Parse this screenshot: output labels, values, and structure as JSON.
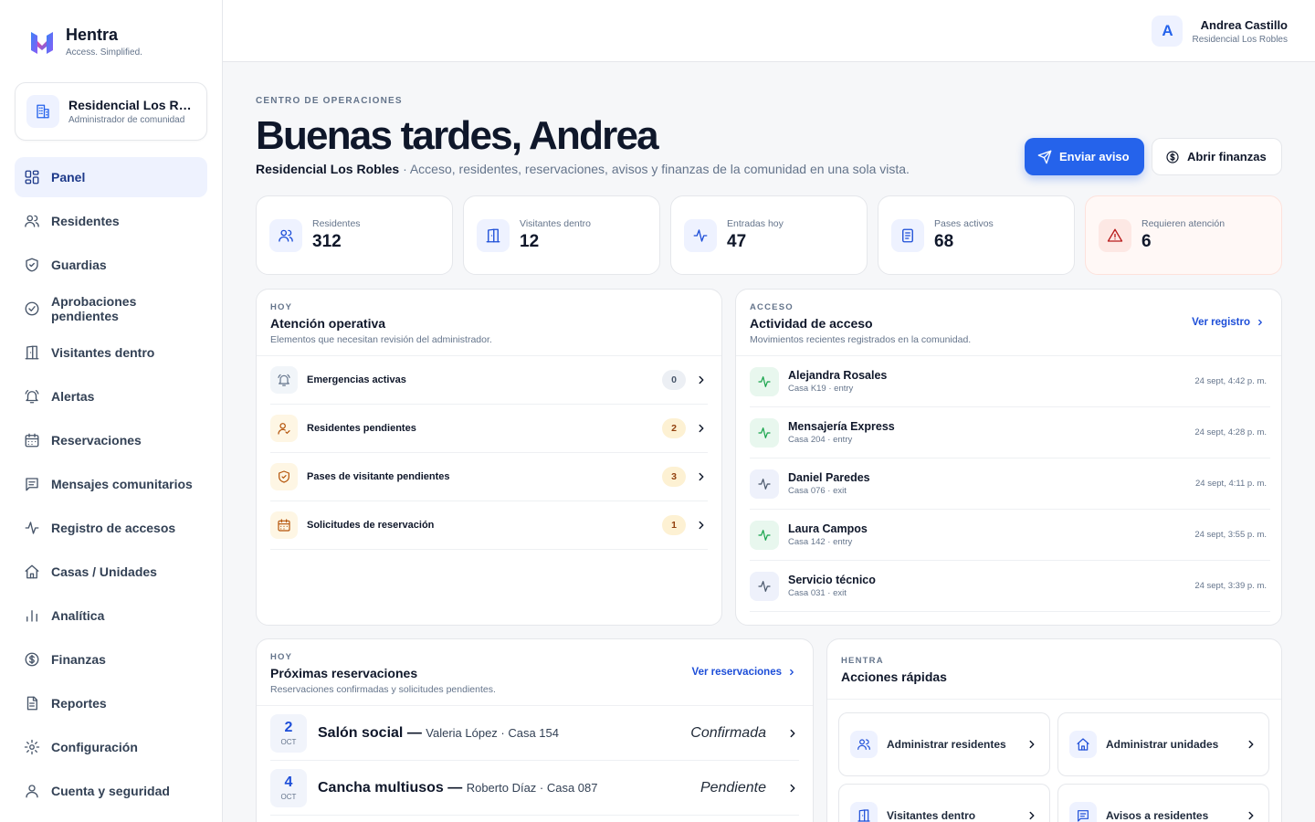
{
  "brand": {
    "name": "Hentra",
    "tagline": "Access. Simplified."
  },
  "community": {
    "name": "Residencial Los Robles",
    "role": "Administrador de comunidad"
  },
  "nav": [
    {
      "label": "Panel",
      "icon": "grid-icon",
      "active": true
    },
    {
      "label": "Residentes",
      "icon": "users-icon"
    },
    {
      "label": "Guardias",
      "icon": "shield-icon"
    },
    {
      "label": "Aprobaciones pendientes",
      "icon": "check-circle-icon"
    },
    {
      "label": "Visitantes dentro",
      "icon": "door-icon"
    },
    {
      "label": "Alertas",
      "icon": "bell-icon"
    },
    {
      "label": "Reservaciones",
      "icon": "calendar-icon"
    },
    {
      "label": "Mensajes comunitarios",
      "icon": "message-icon"
    },
    {
      "label": "Registro de accesos",
      "icon": "activity-icon"
    },
    {
      "label": "Casas / Unidades",
      "icon": "home-icon"
    },
    {
      "label": "Analítica",
      "icon": "bar-chart-icon"
    },
    {
      "label": "Finanzas",
      "icon": "dollar-icon"
    },
    {
      "label": "Reportes",
      "icon": "file-icon"
    },
    {
      "label": "Configuración",
      "icon": "gear-icon"
    },
    {
      "label": "Cuenta y seguridad",
      "icon": "user-icon"
    }
  ],
  "user": {
    "initial": "A",
    "name": "Andrea Castillo",
    "community": "Residencial Los Robles"
  },
  "header": {
    "eyebrow": "CENTRO DE OPERACIONES",
    "title": "Buenas tardes, Andrea",
    "community": "Residencial Los Robles",
    "subtitle": "· Acceso, residentes, reservaciones, avisos y finanzas de la comunidad en una sola vista.",
    "primary_button": "Enviar aviso",
    "secondary_button": "Abrir finanzas"
  },
  "stats": [
    {
      "label": "Residentes",
      "value": "312",
      "icon": "users-icon"
    },
    {
      "label": "Visitantes dentro",
      "value": "12",
      "icon": "door-icon"
    },
    {
      "label": "Entradas hoy",
      "value": "47",
      "icon": "activity-icon"
    },
    {
      "label": "Pases activos",
      "value": "68",
      "icon": "document-icon"
    },
    {
      "label": "Requieren atención",
      "value": "6",
      "icon": "warning-icon"
    }
  ],
  "attention": {
    "eyebrow": "HOY",
    "title": "Atención operativa",
    "subtitle": "Elementos que necesitan revisión del administrador.",
    "items": [
      {
        "label": "Emergencias activas",
        "count": "0",
        "icon": "bell-icon",
        "tone": "neutral"
      },
      {
        "label": "Residentes pendientes",
        "count": "2",
        "icon": "user-check-icon",
        "tone": "amber"
      },
      {
        "label": "Pases de visitante pendientes",
        "count": "3",
        "icon": "shield-icon",
        "tone": "amber"
      },
      {
        "label": "Solicitudes de reservación",
        "count": "1",
        "icon": "calendar-icon",
        "tone": "amber"
      }
    ]
  },
  "activity": {
    "eyebrow": "ACCESO",
    "title": "Actividad de acceso",
    "subtitle": "Movimientos recientes registrados en la comunidad.",
    "link": "Ver registro",
    "items": [
      {
        "name": "Alejandra Rosales",
        "meta": "Casa K19 · entry",
        "time": "24 sept, 4:42 p. m.",
        "type": "entry"
      },
      {
        "name": "Mensajería Express",
        "meta": "Casa 204 · entry",
        "time": "24 sept, 4:28 p. m.",
        "type": "entry"
      },
      {
        "name": "Daniel Paredes",
        "meta": "Casa 076 · exit",
        "time": "24 sept, 4:11 p. m.",
        "type": "exit"
      },
      {
        "name": "Laura Campos",
        "meta": "Casa 142 · entry",
        "time": "24 sept, 3:55 p. m.",
        "type": "entry"
      },
      {
        "name": "Servicio técnico",
        "meta": "Casa 031 · exit",
        "time": "24 sept, 3:39 p. m.",
        "type": "exit"
      }
    ]
  },
  "reservations": {
    "eyebrow": "HOY",
    "title": "Próximas reservaciones",
    "subtitle": "Reservaciones confirmadas y solicitudes pendientes.",
    "link": "Ver reservaciones",
    "items": [
      {
        "day": "2",
        "month": "OCT",
        "title": "Salón social —",
        "details": "Valeria López · Casa 154",
        "status": "Confirmada"
      },
      {
        "day": "4",
        "month": "OCT",
        "title": "Cancha multiusos —",
        "details": "Roberto Díaz · Casa 087",
        "status": "Pendiente"
      }
    ]
  },
  "quick": {
    "eyebrow": "HENTRA",
    "title": "Acciones rápidas",
    "items": [
      {
        "label": "Administrar residentes",
        "icon": "users-icon"
      },
      {
        "label": "Administrar unidades",
        "icon": "home-icon"
      },
      {
        "label": "Visitantes dentro",
        "icon": "door-icon"
      },
      {
        "label": "Avisos a residentes",
        "icon": "message-icon"
      }
    ]
  },
  "colors": {
    "accent": "#2563eb",
    "entry": "#16a34a",
    "exit": "#64748b",
    "amber": "#b45309",
    "danger": "#b91c1c"
  }
}
